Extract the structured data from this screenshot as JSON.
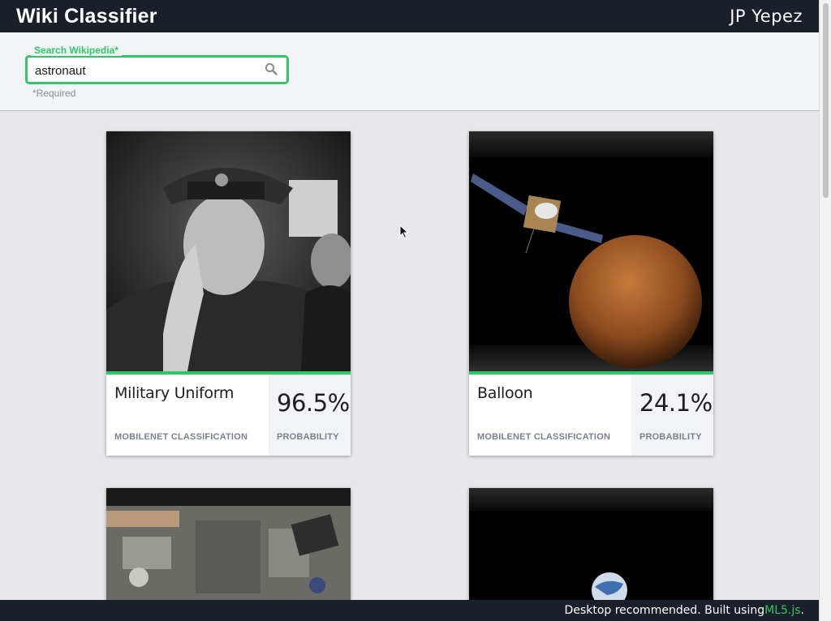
{
  "header": {
    "title": "Wiki Classifier",
    "user": "JP Yepez"
  },
  "search": {
    "label": "Search Wikipedia*",
    "value": "astronaut",
    "required_note": "*Required",
    "icon": "search-icon"
  },
  "results": [
    {
      "classification": "Military Uniform",
      "classification_caption": "MOBILENET CLASSIFICATION",
      "probability": "96.5%",
      "probability_caption": "PROBABILITY"
    },
    {
      "classification": "Balloon",
      "classification_caption": "MOBILENET CLASSIFICATION",
      "probability": "24.1%",
      "probability_caption": "PROBABILITY"
    }
  ],
  "footer": {
    "text": "Desktop recommended. Built using ",
    "link": "ML5.js",
    "suffix": "."
  },
  "colors": {
    "accent": "#2ec866",
    "topbar": "#1b1f2a",
    "background": "#e8e8ec"
  }
}
